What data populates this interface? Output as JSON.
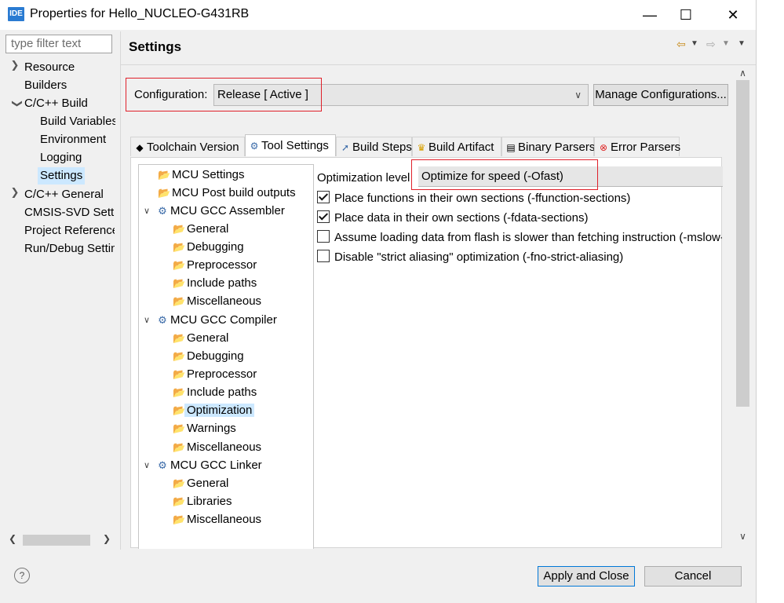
{
  "window": {
    "app_icon": "IDE",
    "title": "Properties for Hello_NUCLEO-G431RB",
    "minimize_glyph": "—",
    "maximize_glyph": "☐",
    "close_glyph": "✕"
  },
  "filter": {
    "placeholder": "type filter text"
  },
  "left_tree": {
    "items": [
      {
        "label": "Resource",
        "chevron": ">"
      },
      {
        "label": "Builders"
      },
      {
        "label": "C/C++ Build",
        "chevron": "v"
      },
      {
        "label": "Build Variables"
      },
      {
        "label": "Environment"
      },
      {
        "label": "Logging"
      },
      {
        "label": "Settings"
      },
      {
        "label": "C/C++ General",
        "chevron": ">"
      },
      {
        "label": "CMSIS-SVD Settings"
      },
      {
        "label": "Project References"
      },
      {
        "label": "Run/Debug Settings"
      }
    ]
  },
  "settings": {
    "title": "Settings",
    "configuration_label": "Configuration:",
    "configuration_value": "Release  [ Active ]",
    "manage_button": "Manage Configurations..."
  },
  "tabs": [
    {
      "label": "Toolchain  Version",
      "icon": "toolchain-icon",
      "glyph": "◆"
    },
    {
      "label": "Tool Settings",
      "icon": "gear-icon",
      "glyph": "⚙"
    },
    {
      "label": "Build Steps",
      "icon": "build-steps-icon",
      "glyph": "➚"
    },
    {
      "label": "Build Artifact",
      "icon": "artifact-icon",
      "glyph": "♛"
    },
    {
      "label": "Binary Parsers",
      "icon": "binary-icon",
      "glyph": "▤"
    },
    {
      "label": "Error Parsers",
      "icon": "error-icon",
      "glyph": "⊗"
    }
  ],
  "tool_tree": [
    {
      "label": "MCU Settings",
      "icon": "folder-tool-icon"
    },
    {
      "label": "MCU Post build outputs",
      "icon": "folder-tool-icon"
    },
    {
      "label": "MCU GCC Assembler",
      "icon": "gear-icon",
      "expander": "v"
    },
    {
      "label": "General",
      "icon": "folder-tool-icon"
    },
    {
      "label": "Debugging",
      "icon": "folder-tool-icon"
    },
    {
      "label": "Preprocessor",
      "icon": "folder-tool-icon"
    },
    {
      "label": "Include paths",
      "icon": "folder-tool-icon"
    },
    {
      "label": "Miscellaneous",
      "icon": "folder-tool-icon"
    },
    {
      "label": "MCU GCC Compiler",
      "icon": "gear-icon",
      "expander": "v"
    },
    {
      "label": "General",
      "icon": "folder-tool-icon"
    },
    {
      "label": "Debugging",
      "icon": "folder-tool-icon"
    },
    {
      "label": "Preprocessor",
      "icon": "folder-tool-icon"
    },
    {
      "label": "Include paths",
      "icon": "folder-tool-icon"
    },
    {
      "label": "Optimization",
      "icon": "folder-tool-icon",
      "selected": true
    },
    {
      "label": "Warnings",
      "icon": "folder-tool-icon"
    },
    {
      "label": "Miscellaneous",
      "icon": "folder-tool-icon"
    },
    {
      "label": "MCU GCC Linker",
      "icon": "gear-icon",
      "expander": "v"
    },
    {
      "label": "General",
      "icon": "folder-tool-icon"
    },
    {
      "label": "Libraries",
      "icon": "folder-tool-icon"
    },
    {
      "label": "Miscellaneous",
      "icon": "folder-tool-icon"
    }
  ],
  "optimization": {
    "level_label": "Optimization level",
    "level_value": "Optimize for speed (-Ofast)",
    "options": [
      {
        "label": "Place functions in their own sections (-ffunction-sections)",
        "checked": true
      },
      {
        "label": "Place data in their own sections (-fdata-sections)",
        "checked": true
      },
      {
        "label": "Assume loading data from flash is slower than fetching instruction (-mslow-flash-data)",
        "checked": false
      },
      {
        "label": "Disable \"strict aliasing\" optimization (-fno-strict-aliasing)",
        "checked": false
      }
    ]
  },
  "footer": {
    "apply_close": "Apply and Close",
    "cancel": "Cancel",
    "help": "?"
  },
  "colors": {
    "highlight_red": "#e0202a",
    "selection": "#cce8ff",
    "app_icon_blue": "#2a7bd2"
  }
}
